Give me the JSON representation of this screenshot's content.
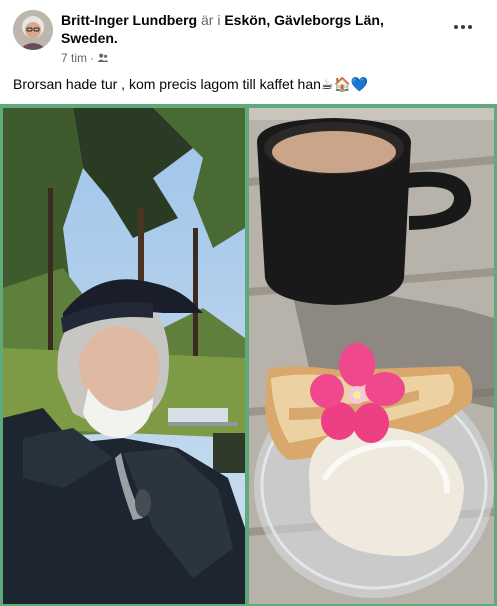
{
  "post": {
    "author": "Britt-Inger Lundberg",
    "connector": "är i",
    "location": "Eskön, Gävleborgs Län, Sweden.",
    "time": "7 tim",
    "separator": "·",
    "audience_icon": "friends-icon",
    "text": "Brorsan hade tur , kom precis lagom till kaffet han☕🏠💙"
  },
  "colors": {
    "gallery_border": "#5fa97a",
    "name_text": "#050505",
    "meta_text": "#65676b"
  }
}
